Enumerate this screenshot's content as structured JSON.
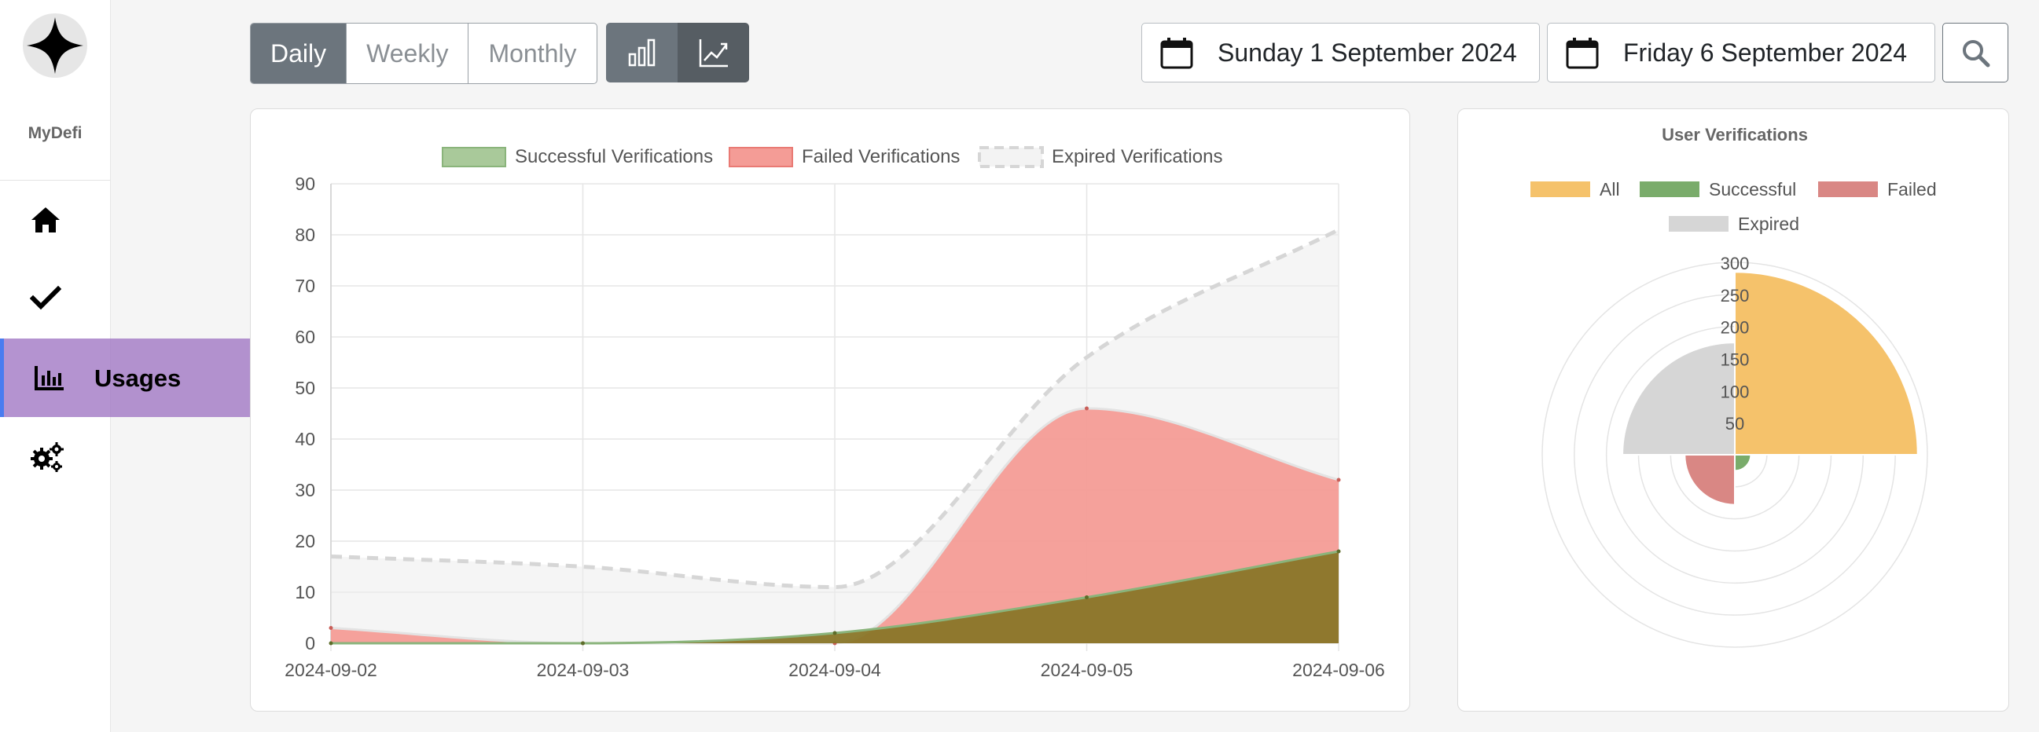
{
  "sidebar": {
    "brand": "MyDefi",
    "items": [
      {
        "name": "home",
        "label": ""
      },
      {
        "name": "verifications",
        "label": ""
      },
      {
        "name": "usages",
        "label": "Usages"
      },
      {
        "name": "settings",
        "label": ""
      }
    ]
  },
  "toolbar": {
    "periods": [
      "Daily",
      "Weekly",
      "Monthly"
    ],
    "selected_period": "Daily",
    "chart_types": [
      "bar-chart",
      "line-chart"
    ],
    "selected_chart_type": "line-chart",
    "start_date": "Sunday 1 September 2024",
    "end_date": "Friday 6 September 2024"
  },
  "colors": {
    "successful": "#a9c99a",
    "failed": "#f49c96",
    "expired": "#d6d6d6",
    "all": "#f5c26b",
    "accent": "#4a7cf0"
  },
  "chart_data": [
    {
      "type": "area",
      "title": "",
      "x": [
        "2024-09-02",
        "2024-09-03",
        "2024-09-04",
        "2024-09-05",
        "2024-09-06"
      ],
      "ylim": [
        0,
        90
      ],
      "yticks": [
        0,
        10,
        20,
        30,
        40,
        50,
        60,
        70,
        80,
        90
      ],
      "grid": true,
      "legend_position": "top",
      "series": [
        {
          "name": "Successful Verifications",
          "values": [
            0,
            0,
            2,
            9,
            18
          ]
        },
        {
          "name": "Failed Verifications",
          "values": [
            3,
            0,
            0,
            46,
            32
          ]
        },
        {
          "name": "Expired Verifications",
          "values": [
            17,
            15,
            11,
            56,
            81
          ]
        }
      ]
    },
    {
      "type": "polarArea",
      "title": "User Verifications",
      "categories": [
        "All",
        "Successful",
        "Failed",
        "Expired"
      ],
      "values": [
        285,
        25,
        78,
        175
      ],
      "rticks": [
        50,
        100,
        150,
        200,
        250,
        300
      ],
      "rmax": 300,
      "legend_position": "top"
    }
  ]
}
